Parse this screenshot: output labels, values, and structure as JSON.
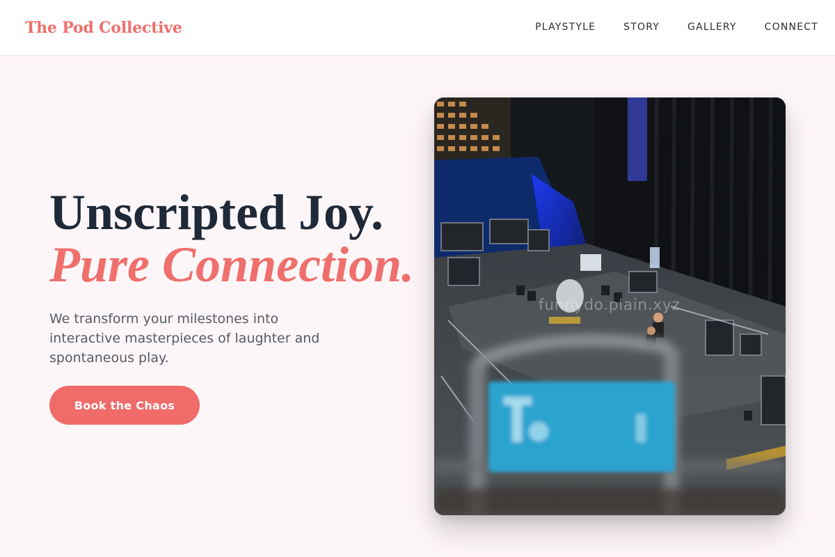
{
  "header": {
    "brand": "The Pod Collective",
    "nav": [
      {
        "label": "PLAYSTYLE"
      },
      {
        "label": "STORY"
      },
      {
        "label": "GALLERY"
      },
      {
        "label": "CONNECT"
      }
    ]
  },
  "hero": {
    "headline_line1": "Unscripted Joy.",
    "headline_line2": "Pure Connection.",
    "subtext": "We transform your milestones into interactive masterpieces of laughter and spontaneous play.",
    "cta_label": "Book the Chaos"
  },
  "photo": {
    "watermark": "funnydo.plain.xyz"
  },
  "colors": {
    "accent": "#ef6f6c",
    "heading": "#1f2937",
    "body_text": "#555b66",
    "page_bg": "#fdf6f8"
  }
}
